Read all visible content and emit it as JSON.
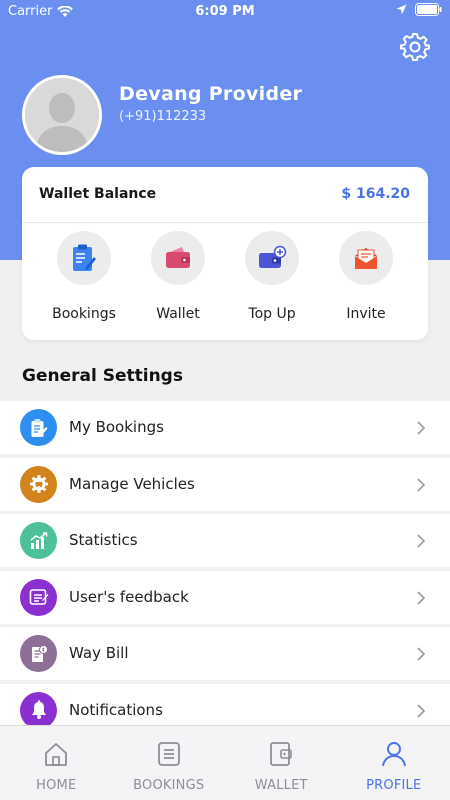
{
  "status_bar": {
    "carrier": "Carrier",
    "time": "6:09 PM"
  },
  "profile": {
    "name": "Devang Provider",
    "phone": "(+91)112233"
  },
  "wallet": {
    "title": "Wallet Balance",
    "amount": "$ 164.20",
    "shortcuts": [
      {
        "label": "Bookings",
        "icon": "bookings-icon",
        "color": "#3b82f6"
      },
      {
        "label": "Wallet",
        "icon": "wallet-icon",
        "color": "#d84a6f"
      },
      {
        "label": "Top Up",
        "icon": "topup-icon",
        "color": "#4b55d6"
      },
      {
        "label": "Invite",
        "icon": "invite-icon",
        "color": "#f0542c"
      }
    ]
  },
  "general_settings": {
    "title": "General Settings",
    "items": [
      {
        "label": "My Bookings",
        "icon": "bookings-icon",
        "color": "#2f8ff0"
      },
      {
        "label": "Manage Vehicles",
        "icon": "vehicle-gear-icon",
        "color": "#d2831b"
      },
      {
        "label": "Statistics",
        "icon": "statistics-icon",
        "color": "#4cc19a"
      },
      {
        "label": "User's feedback",
        "icon": "feedback-icon",
        "color": "#8a2fd0"
      },
      {
        "label": "Way Bill",
        "icon": "waybill-icon",
        "color": "#8e6f96"
      },
      {
        "label": "Notifications",
        "icon": "bell-icon",
        "color": "#8a2fd0"
      }
    ]
  },
  "tabbar": {
    "tabs": [
      {
        "label": "HOME",
        "icon": "home-icon",
        "active": false
      },
      {
        "label": "BOOKINGS",
        "icon": "list-icon",
        "active": false
      },
      {
        "label": "WALLET",
        "icon": "wallet-icon",
        "active": false
      },
      {
        "label": "PROFILE",
        "icon": "user-icon",
        "active": true
      }
    ]
  },
  "colors": {
    "header": "#6b8ff0",
    "accent": "#4a73e8"
  }
}
